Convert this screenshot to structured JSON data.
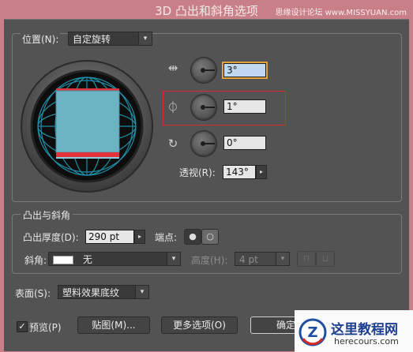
{
  "window": {
    "title": "3D 凸出和斜角选项",
    "watermark_top": "思缘设计论坛 www.MISSYUAN.com"
  },
  "position": {
    "label": "位置(N):",
    "value": "自定旋转"
  },
  "rotation": [
    {
      "icon": "x-axis-rotate-icon",
      "glyph": "⇹",
      "value": "3°"
    },
    {
      "icon": "y-axis-rotate-icon",
      "glyph": "⏀",
      "value": "1°"
    },
    {
      "icon": "z-axis-rotate-icon",
      "glyph": "↻",
      "value": "0°"
    }
  ],
  "perspective": {
    "label": "透视(R):",
    "value": "143°",
    "arrow": "▸"
  },
  "extrude": {
    "section_label": "凸出与斜角",
    "depth_label": "凸出厚度(D):",
    "depth_value": "290 pt",
    "depth_arrow": "▸",
    "cap_label": "端点:",
    "cap_on_glyph": "●",
    "cap_off_glyph": "○",
    "bevel_label": "斜角:",
    "bevel_value": "无",
    "height_label": "高度(H):",
    "height_value": "4 pt",
    "bevel_out_glyph": "⊓",
    "bevel_in_glyph": "⊔"
  },
  "surface": {
    "label": "表面(S):",
    "value": "塑料效果底纹"
  },
  "footer": {
    "preview_label": "预览(P)",
    "preview_checked": "✓",
    "map_button": "贴图(M)...",
    "more_button": "更多选项(O)",
    "ok_button": "确定"
  },
  "dropdown_arrow": "▾",
  "watermark": {
    "site_title": "这里教程网",
    "site_url": "herecours.com",
    "logo_letter": "Z"
  },
  "colors": {
    "highlight_border": "#d92b2b",
    "cube_face": "#6cb3c4",
    "cube_edge": "#e0343c",
    "grid": "#1f8ea6"
  }
}
